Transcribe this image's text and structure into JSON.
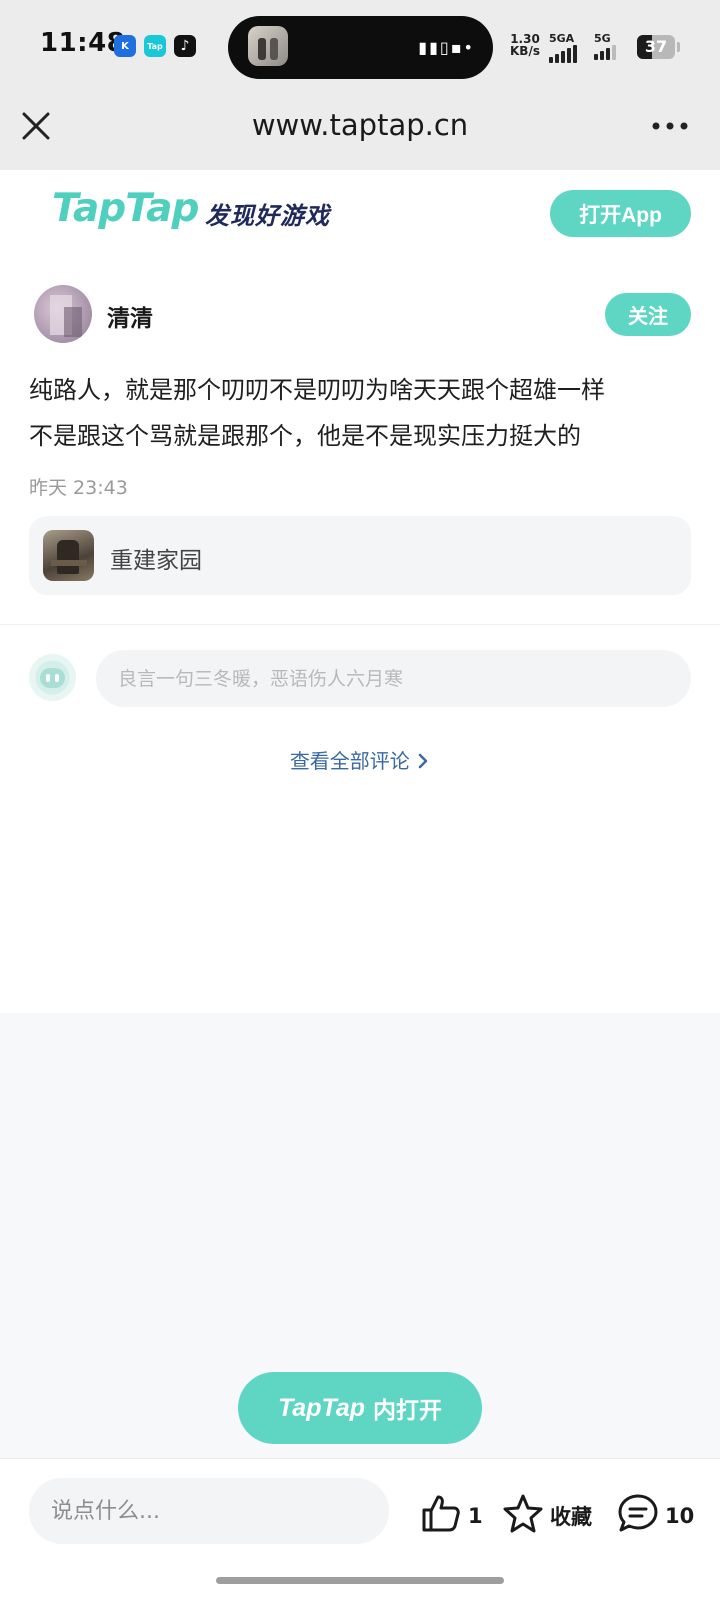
{
  "status_bar": {
    "time": "11:48",
    "speed_value": "1.30",
    "speed_unit": "KB/s",
    "signal1_label": "5GA",
    "signal2_label": "5G",
    "battery": "37",
    "app_icons": [
      "k-app-icon",
      "taptap-icon",
      "tiktok-icon"
    ]
  },
  "browser": {
    "url": "www.taptap.cn"
  },
  "header": {
    "logo": "TapTap",
    "slogan": "发现好游戏",
    "open_app": "打开App"
  },
  "post": {
    "username": "清清",
    "follow": "关注",
    "content_line1": "纯路人，就是那个叨叨不是叨叨为啥天天跟个超雄一样",
    "content_line2": "不是跟这个骂就是跟那个，他是不是现实压力挺大的",
    "time": "昨天 23:43",
    "game_name": "重建家园"
  },
  "comment": {
    "placeholder": "良言一句三冬暖，恶语伤人六月寒",
    "view_all": "查看全部评论"
  },
  "open_in": {
    "brand": "TapTap",
    "label": "内打开"
  },
  "bottom_bar": {
    "placeholder": "说点什么...",
    "likes": "1",
    "favorite": "收藏",
    "comments": "10"
  },
  "colors": {
    "accent": "#5fd6c4",
    "link": "#3a6aa0",
    "slogan": "#1f2a5a"
  }
}
